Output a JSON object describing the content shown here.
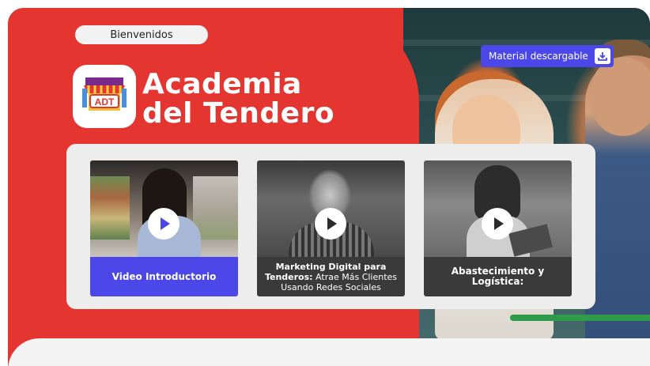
{
  "header": {
    "welcome_label": "Bienvenidos",
    "title_line1": "Academia",
    "title_line2": "del Tendero",
    "logo_text": "ADT",
    "download_label": "Material descargable"
  },
  "cards": [
    {
      "caption_bold": "Video Introductorio",
      "caption_rest": ""
    },
    {
      "caption_bold": "Marketing Digital para Tenderos:",
      "caption_rest": " Atrae Más Clientes Usando Redes Sociales"
    },
    {
      "caption_bold": "Abastecimiento y Logística:",
      "caption_rest": ""
    }
  ],
  "colors": {
    "brand_red": "#e43530",
    "accent_blue": "#4b47e8",
    "panel_gray": "#ededed"
  },
  "icons": [
    "download-icon",
    "play-icon",
    "adt-store-logo"
  ]
}
